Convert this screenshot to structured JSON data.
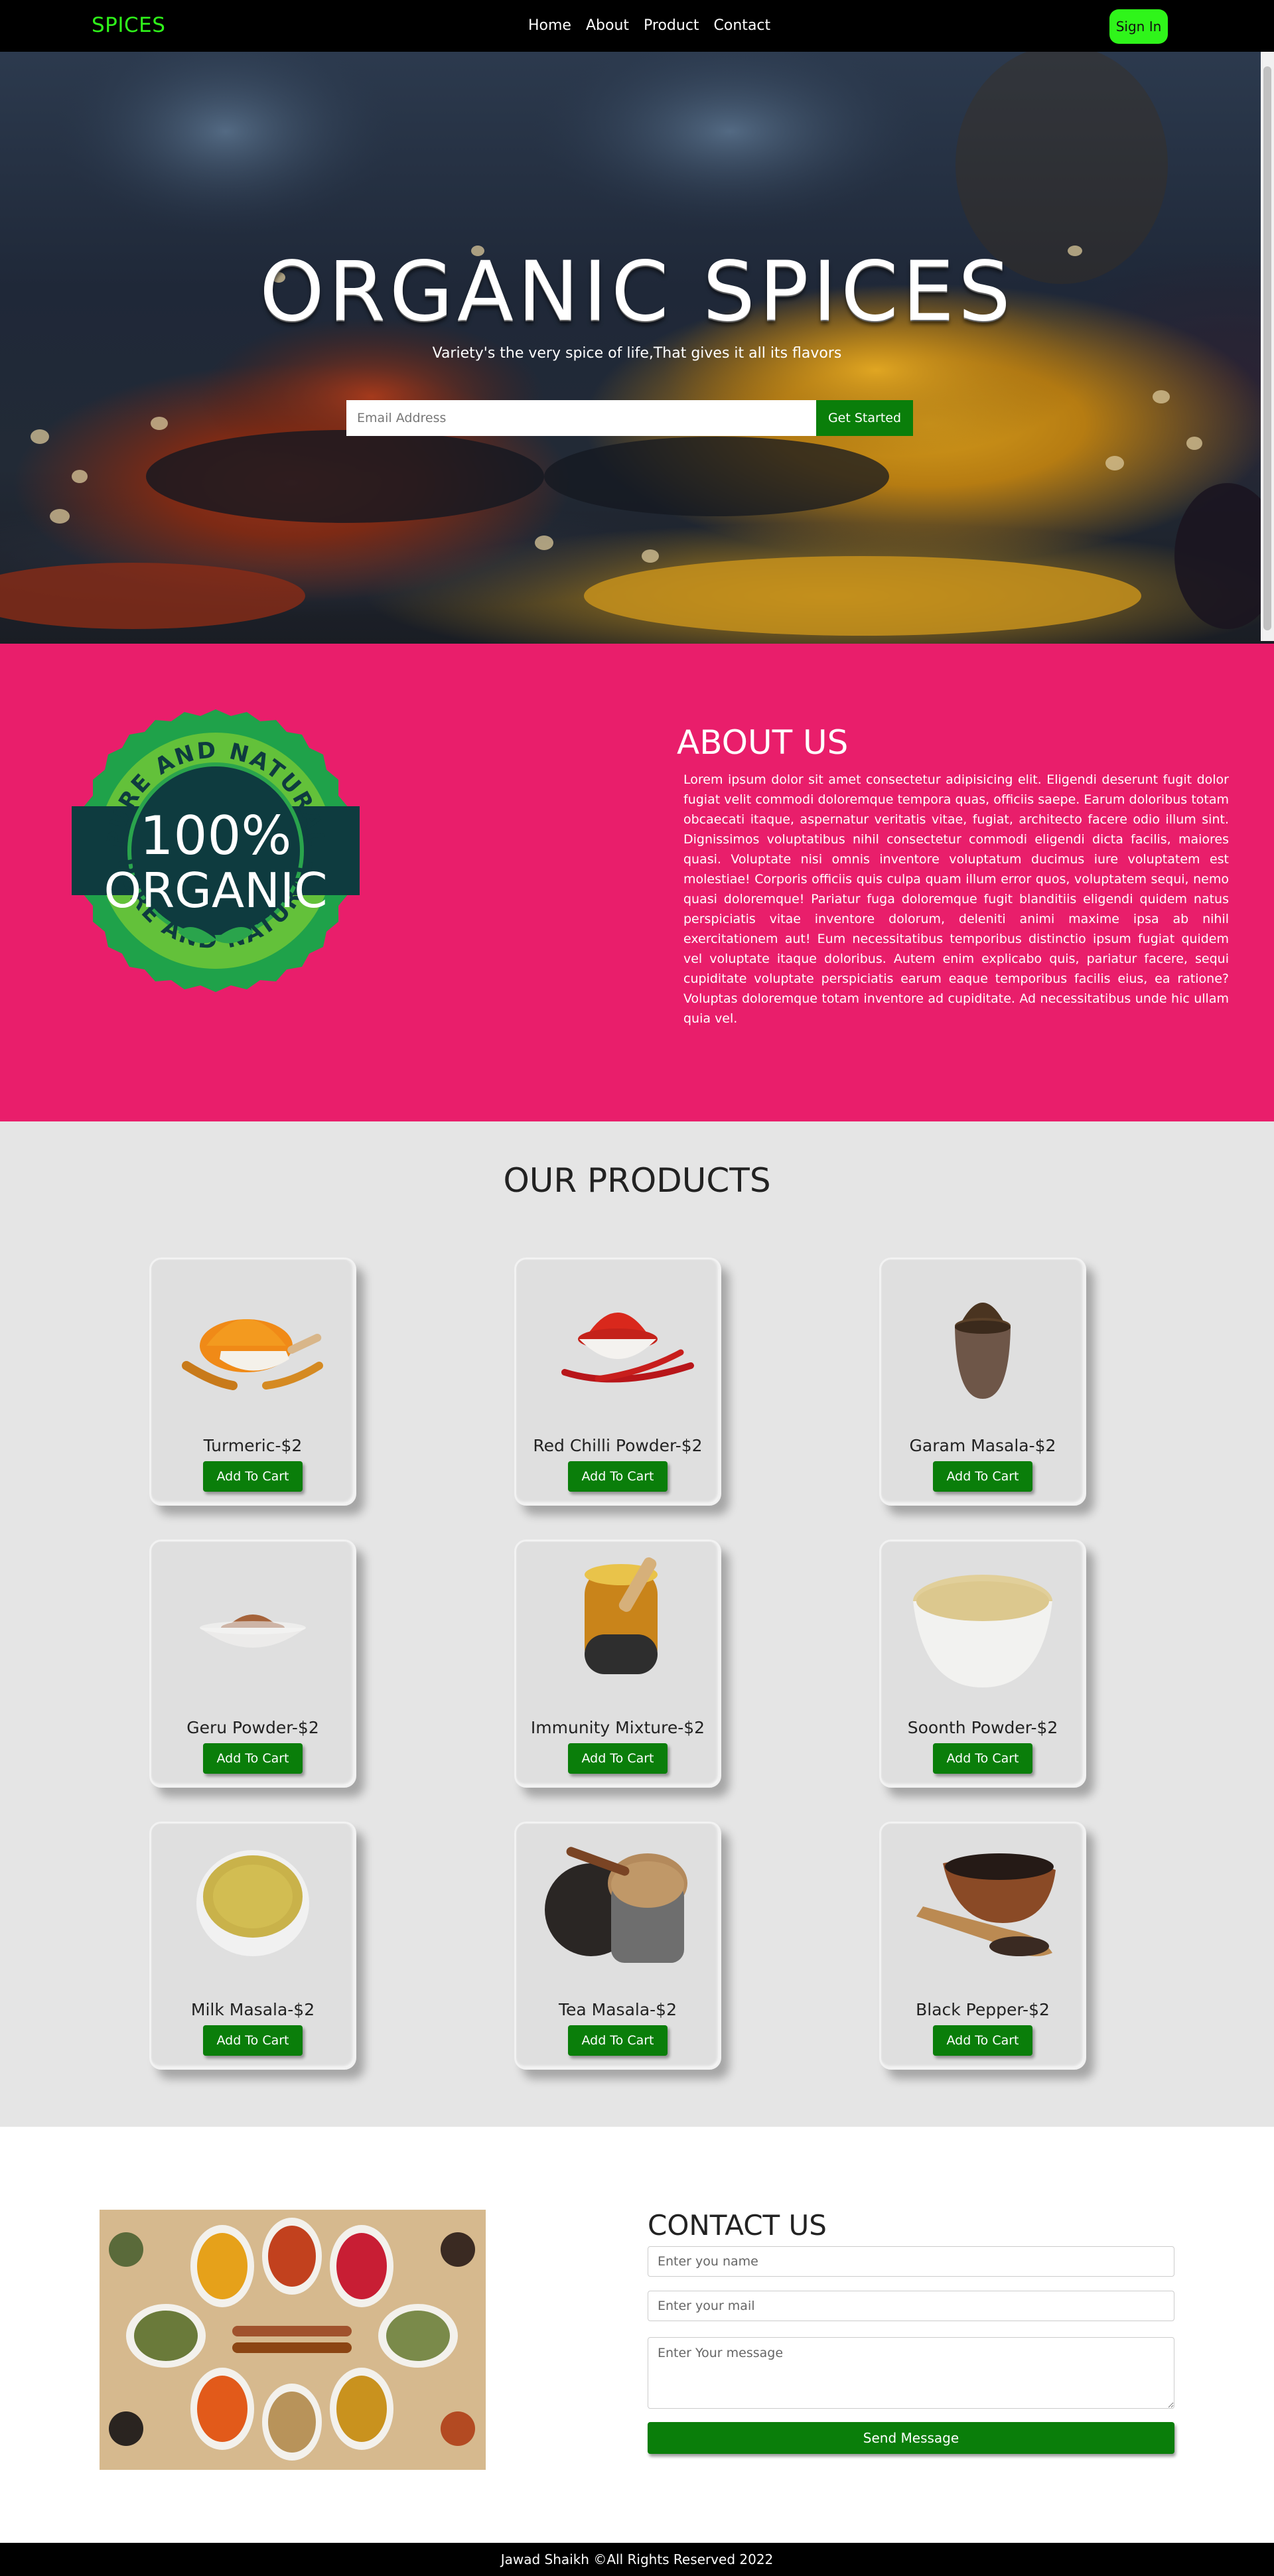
{
  "nav": {
    "brand": "SPICES",
    "links": [
      "Home",
      "About",
      "Product",
      "Contact"
    ],
    "signin_label": "Sign In",
    "brand_color": "#2ff51a"
  },
  "hero": {
    "title": "ORGANIC SPICES",
    "subtitle": "Variety's the very spice of life,That gives it all its flavors",
    "email_placeholder": "Email Address",
    "cta_label": "Get Started"
  },
  "about": {
    "title": "ABOUT US",
    "badge": {
      "top_text": "PURE AND NATURAL",
      "center_line1": "100%",
      "center_line2": "ORGANIC",
      "bottom_text": "PURE AND NATURAL"
    },
    "text": "Lorem ipsum dolor sit amet consectetur adipisicing elit. Eligendi deserunt fugit dolor fugiat velit commodi doloremque tempora quas, officiis saepe. Earum doloribus totam obcaecati itaque, aspernatur veritatis vitae, fugiat, architecto facere odio illum sint. Dignissimos voluptatibus nihil consectetur commodi eligendi dicta facilis, maiores quasi. Voluptate nisi omnis inventore voluptatum ducimus iure voluptatem est molestiae! Corporis officiis quis culpa quam illum error quos, voluptatem sequi, nemo quasi doloremque! Pariatur fuga doloremque fugit blanditiis eligendi quidem natus perspiciatis vitae inventore dolorum, deleniti animi maxime ipsa ab nihil exercitationem aut! Eum necessitatibus temporibus distinctio ipsum fugiat quidem vel voluptate itaque doloribus. Autem enim explicabo quis, pariatur facere, sequi cupiditate voluptate perspiciatis earum eaque temporibus facilis eius, ea ratione? Voluptas doloremque totam inventore ad cupiditate. Ad necessitatibus unde hic ullam quia vel.",
    "bg_color": "#e91e6b"
  },
  "products": {
    "title": "OUR PRODUCTS",
    "button_label": "Add To Cart",
    "items": [
      {
        "name": "Turmeric-$2",
        "image": "turmeric"
      },
      {
        "name": "Red Chilli Powder-$2",
        "image": "red-chilli"
      },
      {
        "name": "Garam Masala-$2",
        "image": "garam-masala"
      },
      {
        "name": "Geru Powder-$2",
        "image": "geru"
      },
      {
        "name": "Immunity Mixture-$2",
        "image": "immunity-jar"
      },
      {
        "name": "Soonth Powder-$2",
        "image": "soonth"
      },
      {
        "name": "Milk Masala-$2",
        "image": "milk-masala"
      },
      {
        "name": "Tea Masala-$2",
        "image": "tea-masala"
      },
      {
        "name": "Black Pepper-$2",
        "image": "black-pepper"
      }
    ]
  },
  "contact": {
    "title": "CONTACT US",
    "name_placeholder": "Enter you name",
    "mail_placeholder": "Enter your mail",
    "message_placeholder": "Enter Your message",
    "send_label": "Send Message"
  },
  "footer": {
    "text": "Jawad Shaikh ©All Rights Reserved 2022"
  },
  "accent_green": "#0a7e0a"
}
